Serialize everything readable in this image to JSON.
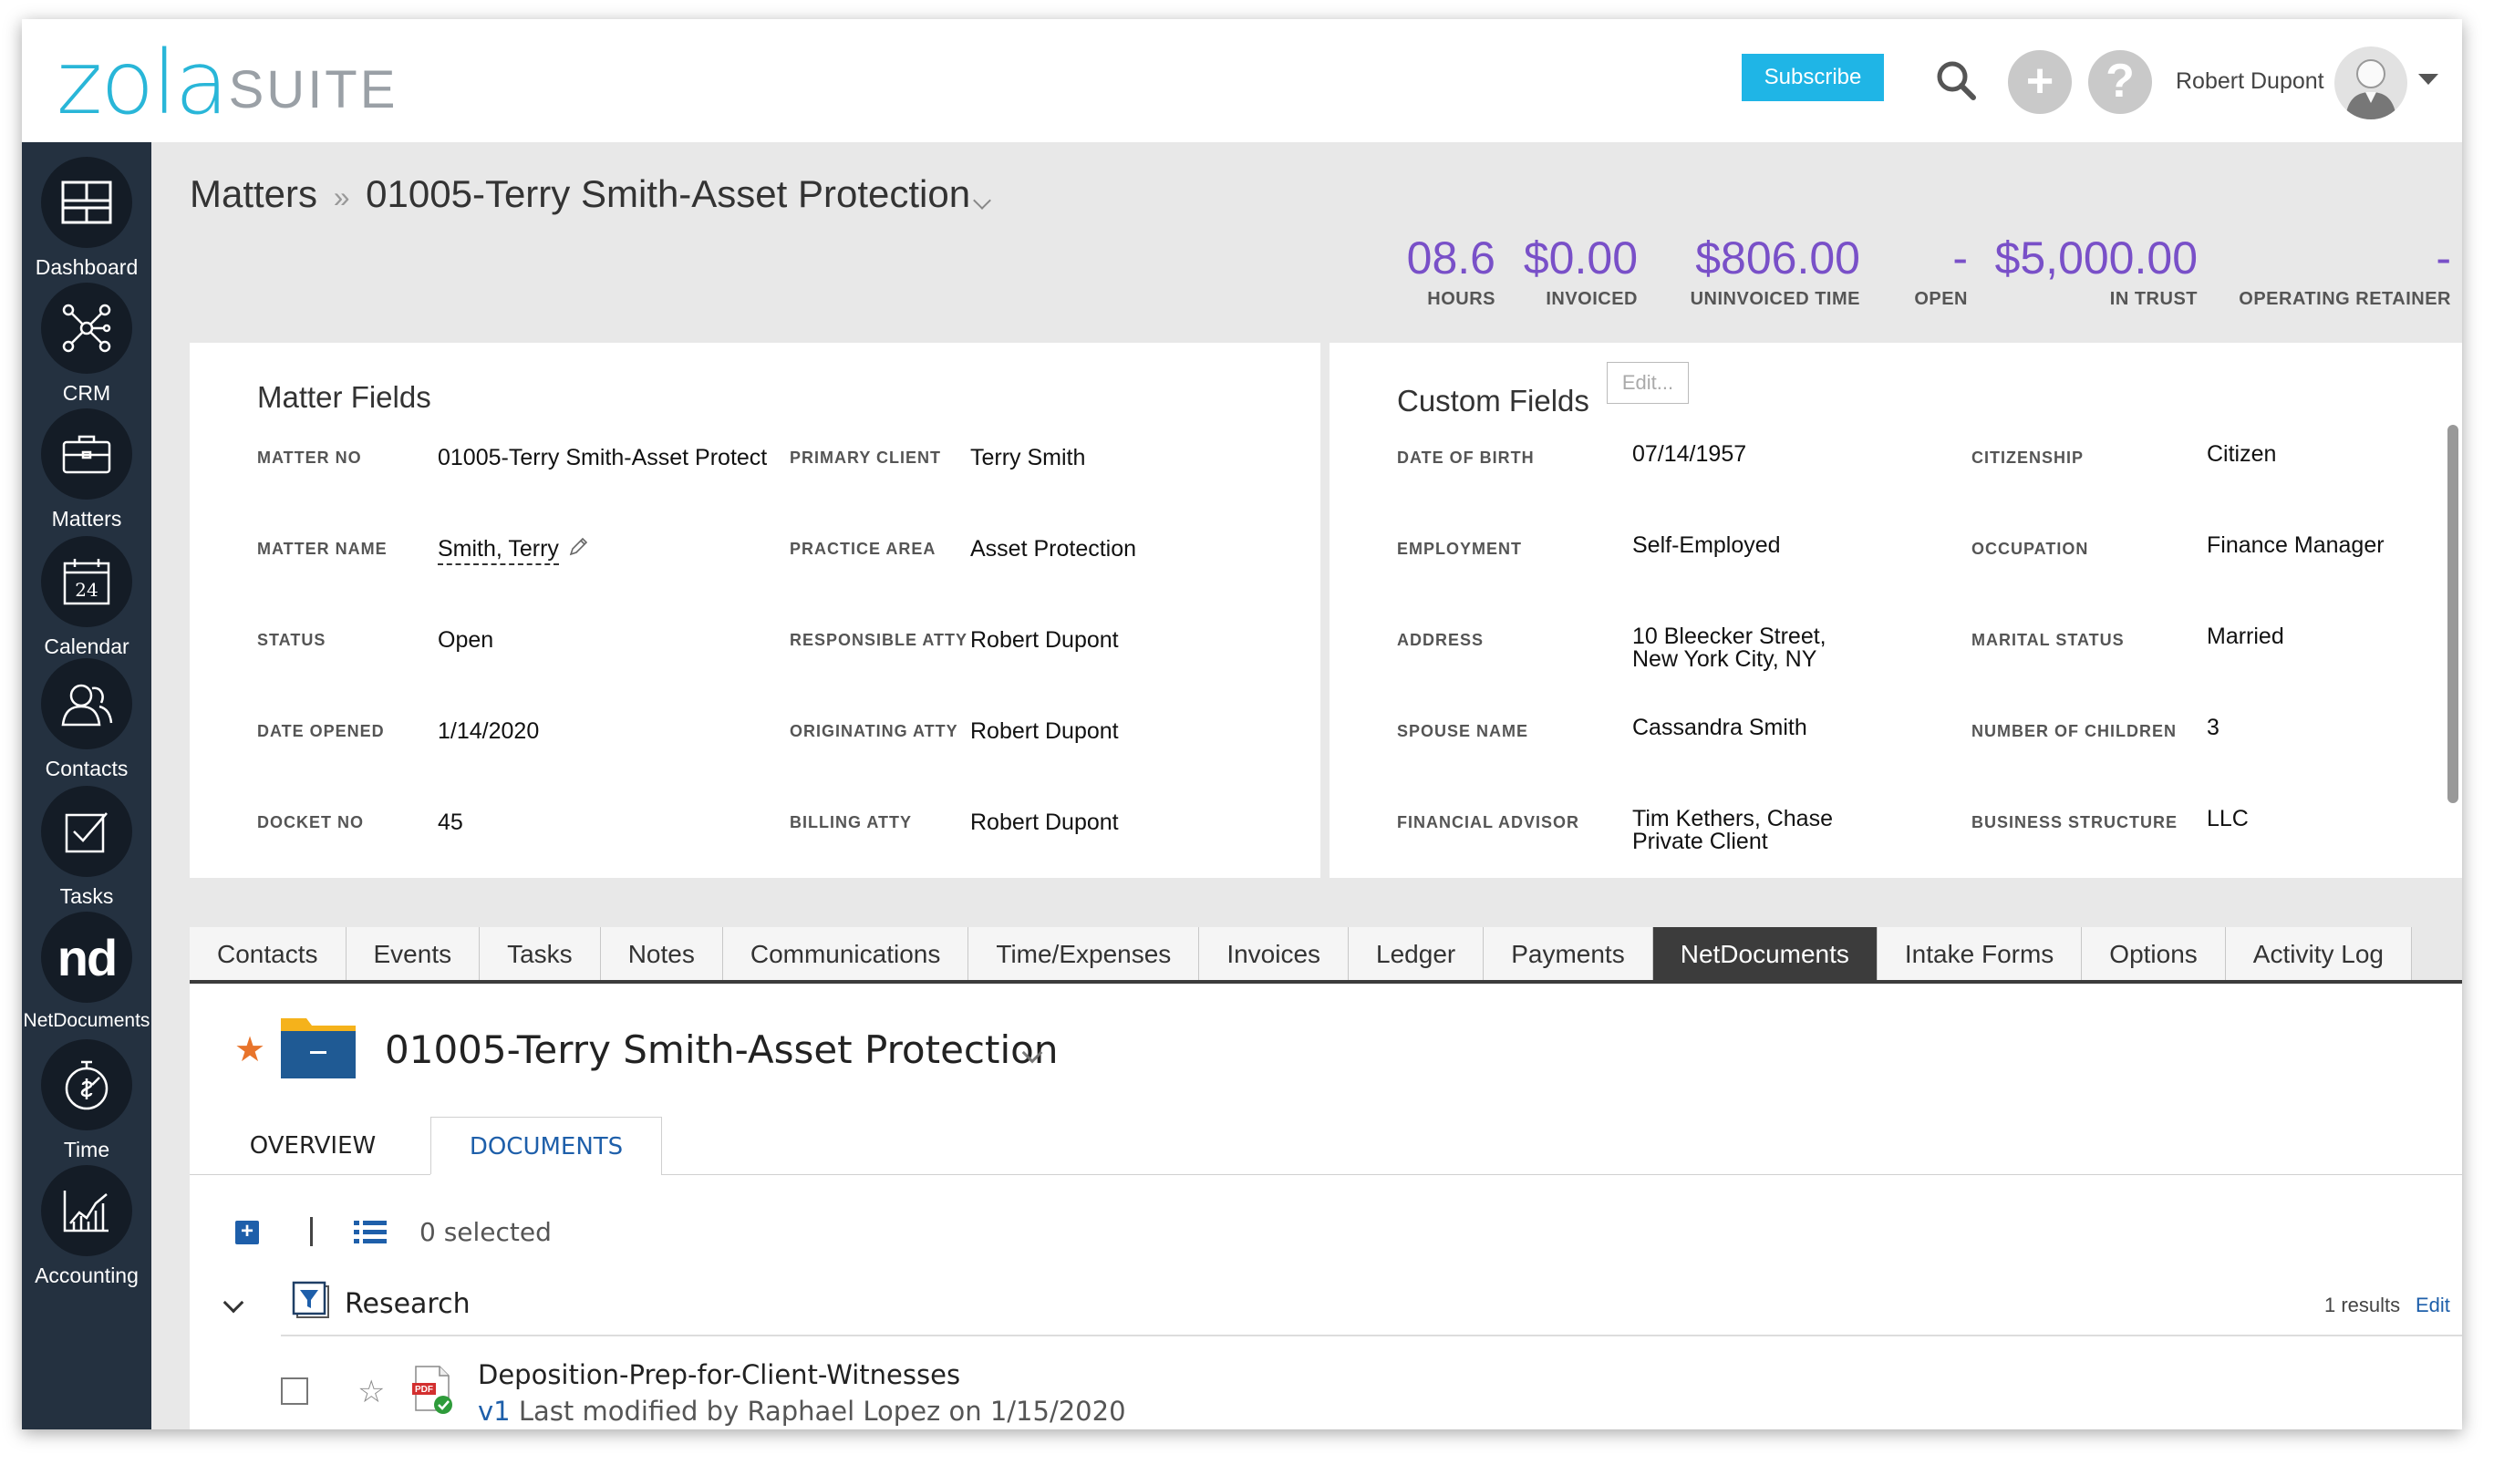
{
  "header": {
    "logo_primary": "zola",
    "logo_secondary": "SUITE",
    "subscribe_label": "Subscribe",
    "user_name": "Robert Dupont",
    "add_symbol": "+",
    "help_symbol": "?"
  },
  "sidebar": {
    "items": [
      {
        "label": "Dashboard",
        "icon": "dashboard-icon"
      },
      {
        "label": "CRM",
        "icon": "network-icon"
      },
      {
        "label": "Matters",
        "icon": "briefcase-icon"
      },
      {
        "label": "Calendar",
        "icon": "calendar-icon",
        "day": "24"
      },
      {
        "label": "Contacts",
        "icon": "contacts-icon"
      },
      {
        "label": "Tasks",
        "icon": "checkbox-icon"
      },
      {
        "label": "NetDocuments",
        "icon": "netdocuments-icon",
        "badge": "nd"
      },
      {
        "label": "Time",
        "icon": "stopwatch-icon"
      },
      {
        "label": "Accounting",
        "icon": "chart-icon"
      }
    ]
  },
  "breadcrumb": {
    "root": "Matters",
    "separator": "»",
    "current": "01005-Terry Smith-Asset Protection"
  },
  "stats": [
    {
      "value": "08.6",
      "label": "HOURS"
    },
    {
      "value": "$0.00",
      "label": "INVOICED"
    },
    {
      "value": "$806.00",
      "label": "UNINVOICED TIME"
    },
    {
      "value": "-",
      "label": "OPEN"
    },
    {
      "value": "$5,000.00",
      "label": "IN TRUST"
    },
    {
      "value": "-",
      "label": "OPERATING RETAINER"
    }
  ],
  "matter_fields": {
    "title": "Matter Fields",
    "left": [
      {
        "label": "MATTER NO",
        "value": "01005-Terry Smith-Asset Protect"
      },
      {
        "label": "MATTER NAME",
        "value": "Smith, Terry"
      },
      {
        "label": "STATUS",
        "value": "Open"
      },
      {
        "label": "DATE OPENED",
        "value": "1/14/2020"
      },
      {
        "label": "DOCKET NO",
        "value": "45"
      }
    ],
    "right": [
      {
        "label": "PRIMARY CLIENT",
        "value": "Terry Smith"
      },
      {
        "label": "PRACTICE AREA",
        "value": "Asset Protection"
      },
      {
        "label": "RESPONSIBLE ATTY",
        "value": "Robert Dupont"
      },
      {
        "label": "ORIGINATING ATTY",
        "value": "Robert Dupont"
      },
      {
        "label": "BILLING ATTY",
        "value": "Robert Dupont"
      }
    ]
  },
  "custom_fields": {
    "title": "Custom Fields",
    "edit_label": "Edit...",
    "left": [
      {
        "label": "DATE OF BIRTH",
        "value": "07/14/1957",
        "value2": ""
      },
      {
        "label": "EMPLOYMENT",
        "value": "Self-Employed",
        "value2": ""
      },
      {
        "label": "ADDRESS",
        "value": "10 Bleecker Street,",
        "value2": "New York City, NY"
      },
      {
        "label": "SPOUSE NAME",
        "value": "Cassandra Smith",
        "value2": ""
      },
      {
        "label": "FINANCIAL ADVISOR",
        "value": "Tim Kethers, Chase",
        "value2": "Private Client"
      }
    ],
    "right": [
      {
        "label": "CITIZENSHIP",
        "value": "Citizen"
      },
      {
        "label": "OCCUPATION",
        "value": "Finance Manager"
      },
      {
        "label": "MARITAL STATUS",
        "value": "Married"
      },
      {
        "label": "NUMBER OF CHILDREN",
        "value": "3"
      },
      {
        "label": "BUSINESS STRUCTURE",
        "value": "LLC"
      }
    ]
  },
  "tabs": [
    {
      "label": "Contacts",
      "active": false
    },
    {
      "label": "Events",
      "active": false
    },
    {
      "label": "Tasks",
      "active": false
    },
    {
      "label": "Notes",
      "active": false
    },
    {
      "label": "Communications",
      "active": false
    },
    {
      "label": "Time/Expenses",
      "active": false
    },
    {
      "label": "Invoices",
      "active": false
    },
    {
      "label": "Ledger",
      "active": false
    },
    {
      "label": "Payments",
      "active": false
    },
    {
      "label": "NetDocuments",
      "active": true
    },
    {
      "label": "Intake Forms",
      "active": false
    },
    {
      "label": "Options",
      "active": false
    },
    {
      "label": "Activity Log",
      "active": false
    }
  ],
  "netdocs": {
    "folder_title": "01005-Terry Smith-Asset Protection",
    "subtabs": {
      "overview": "OVERVIEW",
      "documents": "DOCUMENTS"
    },
    "selected_text": "0 selected",
    "group": {
      "name": "Research",
      "results": "1 results",
      "edit": "Edit"
    },
    "document": {
      "name": "Deposition-Prep-for-Client-Witnesses",
      "version": "v1",
      "modified": "Last modified by Raphael Lopez on 1/15/2020"
    }
  },
  "colors": {
    "brand_cyan": "#29b6d8",
    "stat_purple": "#7950c8",
    "sidebar_bg": "#243140",
    "link_blue": "#1e5faa",
    "star_orange": "#e8742b"
  }
}
